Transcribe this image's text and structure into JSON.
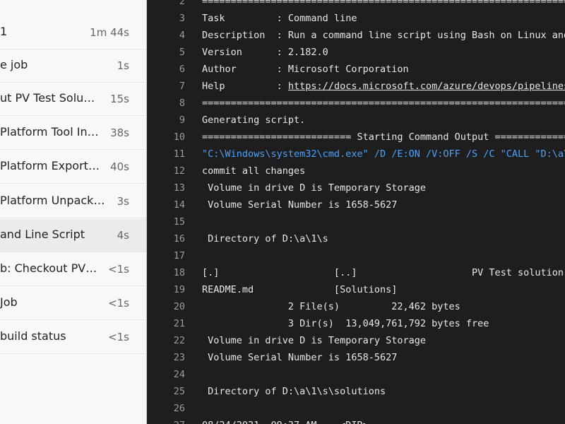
{
  "steps": [
    {
      "name": "1",
      "duration": "1m 44s",
      "selected": false
    },
    {
      "name": "e job",
      "duration": "1s",
      "selected": false
    },
    {
      "name": "ut PV Test Solu…",
      "duration": "15s",
      "selected": false
    },
    {
      "name": "Platform Tool In…",
      "duration": "38s",
      "selected": false
    },
    {
      "name": "Platform Export…",
      "duration": "40s",
      "selected": false
    },
    {
      "name": "Platform Unpack…",
      "duration": "3s",
      "selected": false
    },
    {
      "name": "and Line Script",
      "duration": "4s",
      "selected": true
    },
    {
      "name": "b: Checkout PV…",
      "duration": "<1s",
      "selected": false
    },
    {
      "name": " Job",
      "duration": "<1s",
      "selected": false
    },
    {
      "name": "build status",
      "duration": "<1s",
      "selected": false
    }
  ],
  "log": {
    "lines": [
      {
        "n": "2",
        "text": "=============================================================================="
      },
      {
        "n": "3",
        "text": "Task         : Command line"
      },
      {
        "n": "4",
        "text": "Description  : Run a command line script using Bash on Linux and macOS"
      },
      {
        "n": "5",
        "text": "Version      : 2.182.0"
      },
      {
        "n": "6",
        "text": "Author       : Microsoft Corporation"
      },
      {
        "n": "7",
        "text": "Help         : ",
        "link": "https://docs.microsoft.com/azure/devops/pipelines/tasks"
      },
      {
        "n": "8",
        "text": "=============================================================================="
      },
      {
        "n": "9",
        "text": "Generating script."
      },
      {
        "n": "10",
        "text": "========================== Starting Command Output ==========================="
      },
      {
        "n": "11",
        "text": "\"C:\\Windows\\system32\\cmd.exe\" /D /E:ON /V:OFF /S /C \"CALL \"D:\\a\\_temp",
        "color": "blue"
      },
      {
        "n": "12",
        "text": "commit all changes"
      },
      {
        "n": "13",
        "text": " Volume in drive D is Temporary Storage"
      },
      {
        "n": "14",
        "text": " Volume Serial Number is 1658-5627"
      },
      {
        "n": "15",
        "text": ""
      },
      {
        "n": "16",
        "text": " Directory of D:\\a\\1\\s"
      },
      {
        "n": "17",
        "text": ""
      },
      {
        "n": "18",
        "text": "[.]                    [..]                    PV Test solution.zip"
      },
      {
        "n": "19",
        "text": "README.md              [Solutions]"
      },
      {
        "n": "20",
        "text": "               2 File(s)         22,462 bytes"
      },
      {
        "n": "21",
        "text": "               3 Dir(s)  13,049,761,792 bytes free"
      },
      {
        "n": "22",
        "text": " Volume in drive D is Temporary Storage"
      },
      {
        "n": "23",
        "text": " Volume Serial Number is 1658-5627"
      },
      {
        "n": "24",
        "text": ""
      },
      {
        "n": "25",
        "text": " Directory of D:\\a\\1\\s\\solutions"
      },
      {
        "n": "26",
        "text": ""
      },
      {
        "n": "27",
        "text": "08/24/2021  09:37 AM    <DIR>"
      }
    ]
  }
}
